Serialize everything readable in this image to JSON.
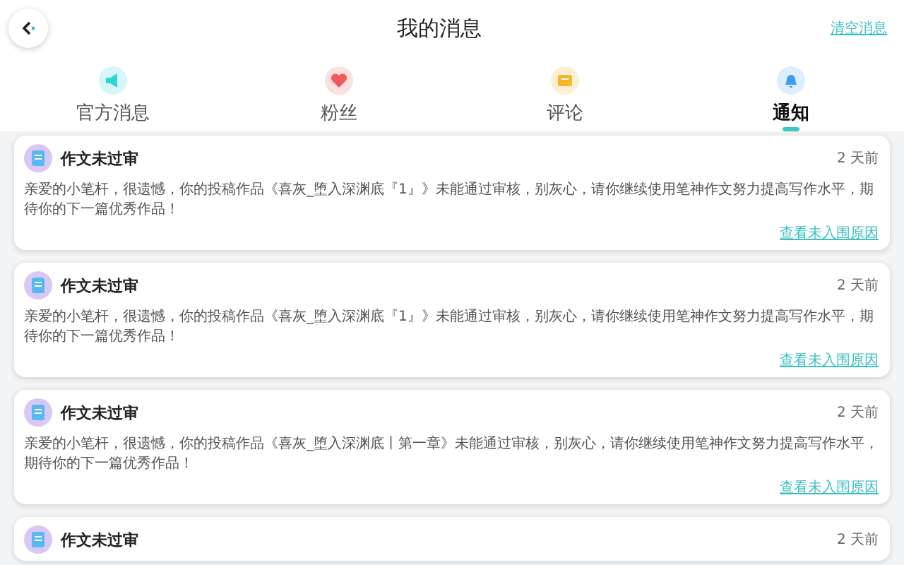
{
  "header": {
    "title": "我的消息",
    "clear_link": "清空消息"
  },
  "tabs": [
    {
      "label": "官方消息",
      "kind": "megaphone",
      "selected": false
    },
    {
      "label": "粉丝",
      "kind": "heart",
      "selected": false
    },
    {
      "label": "评论",
      "kind": "comment",
      "selected": false
    },
    {
      "label": "通知",
      "kind": "bell",
      "selected": true
    }
  ],
  "messages": [
    {
      "title": "作文未过审",
      "time": "2 天前",
      "body": "亲爱的小笔杆，很遗憾，你的投稿作品《喜灰_堕入深渊底『1』》未能通过审核，别灰心，请你继续使用笔神作文努力提高写作水平，期待你的下一篇优秀作品！",
      "link": "查看未入围原因"
    },
    {
      "title": "作文未过审",
      "time": "2 天前",
      "body": "亲爱的小笔杆，很遗憾，你的投稿作品《喜灰_堕入深渊底『1』》未能通过审核，别灰心，请你继续使用笔神作文努力提高写作水平，期待你的下一篇优秀作品！",
      "link": "查看未入围原因"
    },
    {
      "title": "作文未过审",
      "time": "2 天前",
      "body": "亲爱的小笔杆，很遗憾，你的投稿作品《喜灰_堕入深渊底丨第一章》未能通过审核，别灰心，请你继续使用笔神作文努力提高写作水平，期待你的下一篇优秀作品！",
      "link": "查看未入围原因"
    },
    {
      "title": "作文未过审",
      "time": "2 天前"
    }
  ]
}
